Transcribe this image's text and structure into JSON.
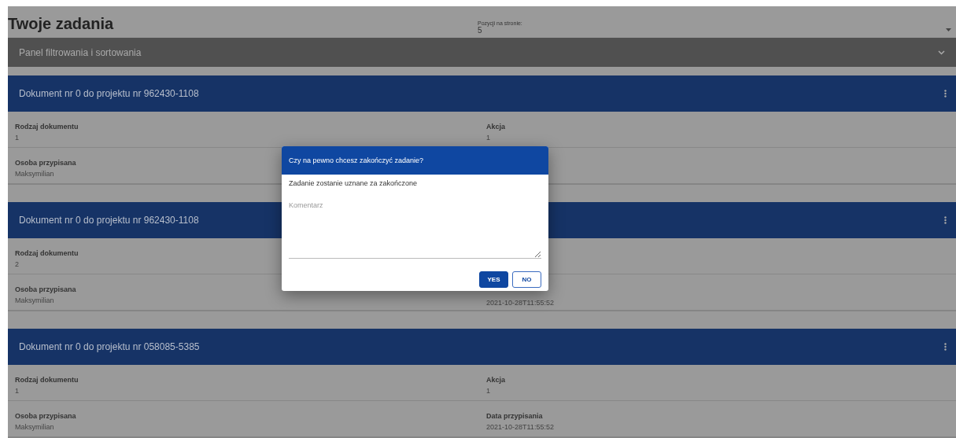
{
  "title": "Twoje zadania",
  "page_size": {
    "label": "Pozycji na stronie:",
    "value": "5"
  },
  "filter_panel": {
    "label": "Panel filtrowania i sortowania",
    "expanded": false
  },
  "tasks": [
    {
      "title": "Dokument nr 0 do projektu nr 962430-1108",
      "rows": [
        [
          {
            "label": "Rodzaj dokumentu",
            "value": "1"
          },
          {
            "label": "Akcja",
            "value": "1"
          }
        ],
        [
          {
            "label": "Osoba przypisana",
            "value": "Maksymilian"
          },
          null
        ]
      ]
    },
    {
      "title": "Dokument nr 0 do projektu nr 962430-1108",
      "rows": [
        [
          {
            "label": "Rodzaj dokumentu",
            "value": "2"
          },
          null
        ],
        [
          {
            "label": "Osoba przypisana",
            "value": "Maksymilian"
          },
          {
            "value": "2021-10-28T11:55:52"
          }
        ]
      ]
    },
    {
      "title": "Dokument nr 0 do projektu nr 058085-5385",
      "rows": [
        [
          {
            "label": "Rodzaj dokumentu",
            "value": "1"
          },
          {
            "label": "Akcja",
            "value": "1"
          }
        ],
        [
          {
            "label": "Osoba przypisana",
            "value": "Maksymilian"
          },
          {
            "label": "Data przypisania",
            "value": "2021-10-28T11:55:52"
          }
        ]
      ]
    }
  ],
  "dialog": {
    "title": "Czy na pewno chcesz zakończyć zadanie?",
    "message": "Zadanie zostanie uznane za zakończone",
    "comment": {
      "placeholder": "Komentarz"
    },
    "buttons": [
      {
        "label": "YES",
        "kind": "primary"
      },
      {
        "label": "NO",
        "kind": "outlined"
      }
    ]
  }
}
